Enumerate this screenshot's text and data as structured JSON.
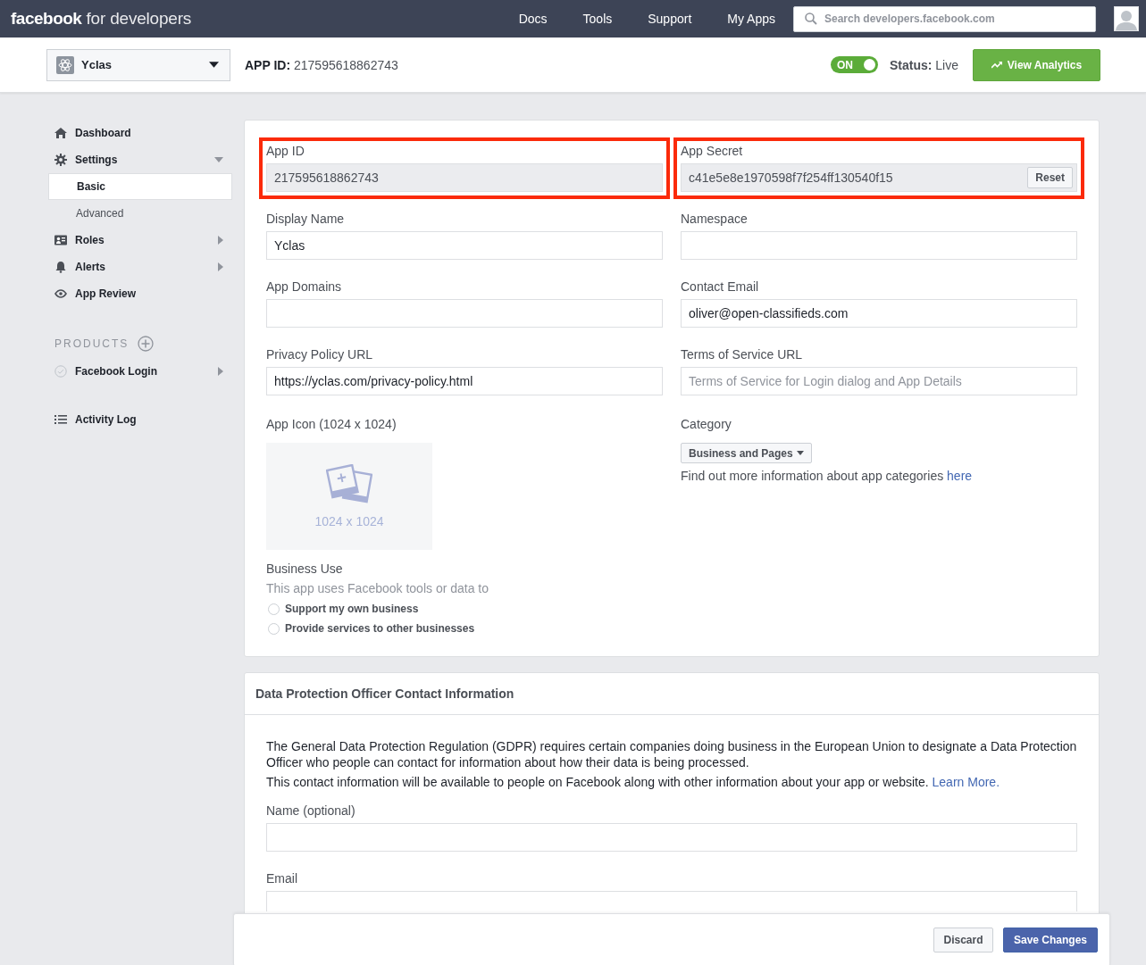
{
  "topbar": {
    "logo_bold": "facebook",
    "logo_light": "for developers",
    "nav": [
      {
        "label": "Docs"
      },
      {
        "label": "Tools"
      },
      {
        "label": "Support"
      },
      {
        "label": "My Apps"
      }
    ],
    "search": {
      "placeholder": "Search developers.facebook.com"
    }
  },
  "app_bar": {
    "app_selector": "Yclas",
    "app_id_label": "APP ID:",
    "app_id": "217595618862743",
    "live_toggle": {
      "label": "ON",
      "on": true
    },
    "status_label": "Status:",
    "status_value": "Live",
    "analytics_button": "View Analytics"
  },
  "sidebar": {
    "items": [
      {
        "label": "Dashboard",
        "selected": false
      },
      {
        "label": "Settings",
        "selected": false,
        "expanded": true,
        "children": [
          {
            "label": "Basic",
            "selected": true
          },
          {
            "label": "Advanced",
            "selected": false
          }
        ]
      },
      {
        "label": "Roles",
        "selected": false,
        "expanded": false
      },
      {
        "label": "Alerts",
        "selected": false,
        "expanded": false
      },
      {
        "label": "App Review",
        "selected": false
      }
    ],
    "products": {
      "heading": "PRODUCTS",
      "items": [
        {
          "label": "Facebook Login",
          "selected": false,
          "expanded": false
        }
      ]
    },
    "footer_items": [
      {
        "label": "Activity Log",
        "selected": false
      }
    ]
  },
  "basic_settings": {
    "fields": [
      {
        "label": "App ID",
        "value": "217595618862743",
        "kind": "readonly",
        "highlighted": true
      },
      {
        "label": "App Secret",
        "value": "c41e5e8e1970598f7f254ff130540f15",
        "kind": "secret",
        "button": "Reset",
        "highlighted": true
      },
      {
        "label": "Display Name",
        "value": "Yclas",
        "kind": "text",
        "highlighted": false
      },
      {
        "label": "Namespace",
        "kind": "text",
        "highlighted": false
      },
      {
        "label": "App Domains",
        "kind": "text",
        "highlighted": false
      },
      {
        "label": "Contact Email",
        "value": "oliver@open-classifieds.com",
        "kind": "text",
        "highlighted": false
      },
      {
        "label": "Privacy Policy URL",
        "value": "https://yclas.com/privacy-policy.html",
        "kind": "text",
        "highlighted": false
      },
      {
        "label": "Terms of Service URL",
        "placeholder": "Terms of Service for Login dialog and App Details",
        "kind": "text",
        "highlighted": false
      }
    ],
    "app_icon": {
      "label": "App Icon (1024 x 1024)",
      "hint": "1024 x 1024"
    },
    "category": {
      "label": "Category",
      "value": "Business and Pages",
      "info": "Find out more information about app categories",
      "link": "here"
    },
    "business_use": {
      "label": "Business Use",
      "hint": "This app uses Facebook tools or data to",
      "options": [
        {
          "label": "Support my own business",
          "selected": false
        },
        {
          "label": "Provide services to other businesses",
          "selected": false
        }
      ]
    }
  },
  "data_protection": {
    "title": "Data Protection Officer Contact Information",
    "paragraph": "The General Data Protection Regulation (GDPR) requires certain companies doing business in the European Union to designate a Data Protection Officer who people can contact for information about how their data is being processed.",
    "note": "This contact information will be available to people on Facebook along with other information about your app or website.",
    "learn_more": "Learn More.",
    "fields": [
      {
        "label": "Name (optional)"
      },
      {
        "label": "Email"
      }
    ]
  },
  "save_bar": {
    "discard": "Discard",
    "save": "Save Changes"
  }
}
